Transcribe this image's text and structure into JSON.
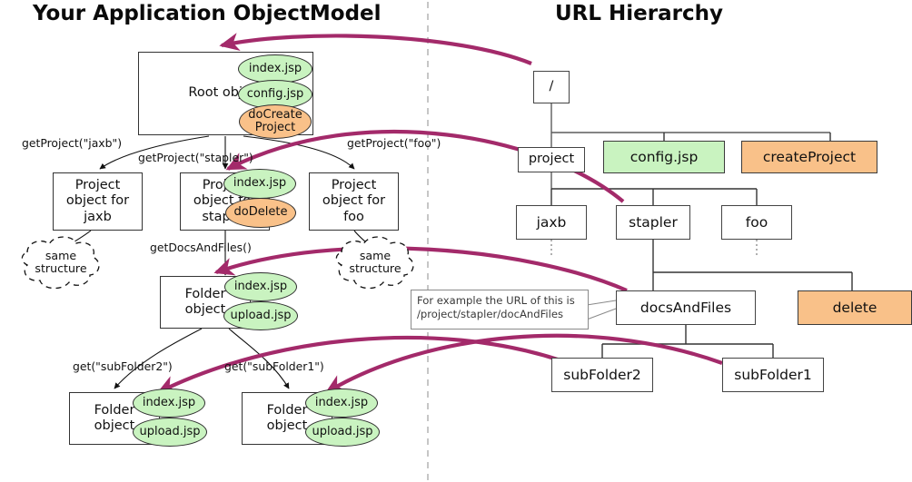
{
  "titles": {
    "left": "Your Application ObjectModel",
    "right": "URL Hierarchy"
  },
  "colors": {
    "green": "#c9f3c0",
    "orange": "#f9c189",
    "arrow": "#a32a6a",
    "box_border": "#3b3b3b",
    "divider": "#b8b8b8"
  },
  "object_model": {
    "root": {
      "label": "Root object"
    },
    "root_bubbles": [
      {
        "label": "index.jsp",
        "kind": "green"
      },
      {
        "label": "config.jsp",
        "kind": "green"
      },
      {
        "label": "doCreate Project",
        "line1": "doCreate",
        "line2": "Project",
        "kind": "orange"
      }
    ],
    "projects": [
      {
        "line1": "Project",
        "line2": "object for",
        "line3": "jaxb"
      },
      {
        "line1": "Project",
        "line2": "object for",
        "line3": "stapler"
      },
      {
        "line1": "Project",
        "line2": "object for",
        "line3": "foo"
      }
    ],
    "stapler_bubbles": [
      {
        "label": "index.jsp",
        "kind": "green"
      },
      {
        "label": "doDelete",
        "kind": "orange"
      }
    ],
    "folder": {
      "line1": "Folder",
      "line2": "object"
    },
    "folder_bubbles": [
      {
        "label": "index.jsp",
        "kind": "green"
      },
      {
        "label": "upload.jsp",
        "kind": "green"
      }
    ],
    "subfolders": [
      {
        "line1": "Folder",
        "line2": "object",
        "bubbles": [
          {
            "label": "index.jsp",
            "kind": "green"
          },
          {
            "label": "upload.jsp",
            "kind": "green"
          }
        ]
      },
      {
        "line1": "Folder",
        "line2": "object",
        "bubbles": [
          {
            "label": "index.jsp",
            "kind": "green"
          },
          {
            "label": "upload.jsp",
            "kind": "green"
          }
        ]
      }
    ],
    "clouds": [
      {
        "line1": "same",
        "line2": "structure"
      },
      {
        "line1": "same",
        "line2": "structure"
      }
    ],
    "edge_labels": [
      {
        "text": "getProject(\"jaxb\")"
      },
      {
        "text": "getProject(\"stapler\")"
      },
      {
        "text": "getProject(\"foo\")"
      },
      {
        "text": "getDocsAndFiles()"
      },
      {
        "text": "get(\"subFolder2\")"
      },
      {
        "text": "get(\"subFolder1\")"
      }
    ]
  },
  "url_hierarchy": {
    "root": {
      "label": "/"
    },
    "level1": [
      {
        "label": "project",
        "kind": "plain"
      },
      {
        "label": "config.jsp",
        "kind": "green"
      },
      {
        "label": "createProject",
        "kind": "orange"
      }
    ],
    "level2": [
      {
        "label": "jaxb",
        "kind": "plain"
      },
      {
        "label": "stapler",
        "kind": "plain"
      },
      {
        "label": "foo",
        "kind": "plain"
      }
    ],
    "level3": [
      {
        "label": "docsAndFiles",
        "kind": "plain"
      },
      {
        "label": "delete",
        "kind": "orange"
      }
    ],
    "level4": [
      {
        "label": "subFolder2",
        "kind": "plain"
      },
      {
        "label": "subFolder1",
        "kind": "plain"
      }
    ],
    "callout": {
      "line1": "For example the URL of this is",
      "line2": "/project/stapler/docAndFiles"
    }
  }
}
